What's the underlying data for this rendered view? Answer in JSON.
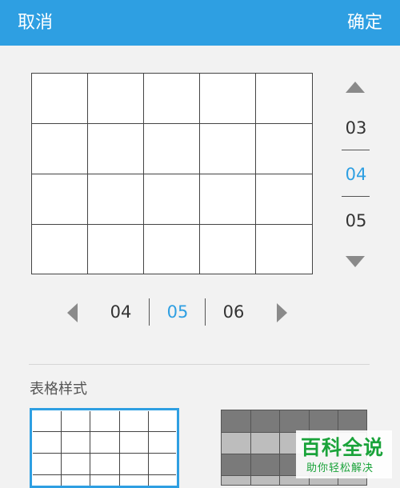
{
  "header": {
    "cancel_label": "取消",
    "confirm_label": "确定"
  },
  "row_picker": {
    "values": [
      "03",
      "04",
      "05"
    ],
    "selected": "04"
  },
  "column_picker": {
    "values": [
      "04",
      "05",
      "06"
    ],
    "selected": "05"
  },
  "table_style": {
    "section_title": "表格样式",
    "options": [
      "plain-grid",
      "striped-gray"
    ]
  },
  "watermark": {
    "title": "百科全说",
    "subtitle": "助你轻松解决"
  },
  "colors": {
    "accent": "#2e9fe2",
    "header_bg": "#2e9fe2",
    "background": "#f2f2f2",
    "stripe_dark": "#7a7a7a",
    "stripe_light": "#bdbdbd",
    "watermark": "#1aa33a"
  }
}
